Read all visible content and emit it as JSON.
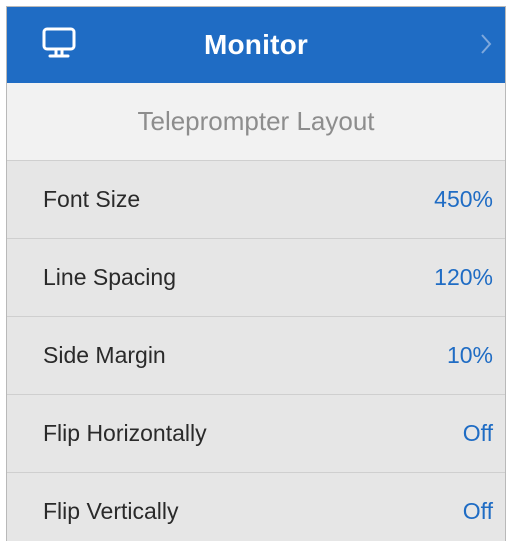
{
  "header": {
    "icon": "monitor-icon",
    "title": "Monitor",
    "chevron": "chevron-right-icon",
    "accent_color": "#1f6cc4"
  },
  "section": {
    "title": "Teleprompter Layout"
  },
  "rows": [
    {
      "label": "Font Size",
      "value": "450%"
    },
    {
      "label": "Line Spacing",
      "value": "120%"
    },
    {
      "label": "Side Margin",
      "value": "10%"
    },
    {
      "label": "Flip Horizontally",
      "value": "Off"
    },
    {
      "label": "Flip Vertically",
      "value": "Off"
    }
  ]
}
